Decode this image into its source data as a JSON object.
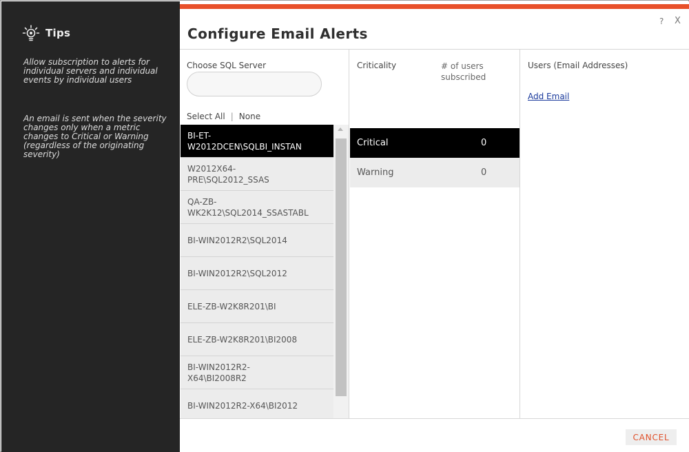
{
  "tips": {
    "title": "Tips",
    "paragraph_1": "Allow subscription to alerts for individual servers and individual events by individual users",
    "paragraph_2": "An email is sent when the severity changes only when a metric changes to Critical or Warning (regardless of the originating severity)"
  },
  "dialog": {
    "title": "Configure Email Alerts",
    "help_label": "?",
    "close_label": "X"
  },
  "server_column": {
    "label": "Choose SQL Server",
    "search_value": "",
    "select_all": "Select All",
    "separator": "|",
    "none": "None",
    "servers": [
      {
        "name": "BI-ET-\nW2012DCEN\\SQLBI_INSTAN",
        "selected": true
      },
      {
        "name": "W2012X64-\nPRE\\SQL2012_SSAS",
        "selected": false
      },
      {
        "name": "QA-ZB-\nWK2K12\\SQL2014_SSASTABL",
        "selected": false
      },
      {
        "name": "BI-WIN2012R2\\SQL2014",
        "selected": false
      },
      {
        "name": "BI-WIN2012R2\\SQL2012",
        "selected": false
      },
      {
        "name": "ELE-ZB-W2K8R201\\BI",
        "selected": false
      },
      {
        "name": "ELE-ZB-W2K8R201\\BI2008",
        "selected": false
      },
      {
        "name": "BI-WIN2012R2-\nX64\\BI2008R2",
        "selected": false
      },
      {
        "name": "BI-WIN2012R2-X64\\BI2012",
        "selected": false
      }
    ]
  },
  "criticality_column": {
    "label": "Criticality",
    "users_label": "# of users\nsubscribed",
    "rows": [
      {
        "name": "Critical",
        "count": "0",
        "selected": true
      },
      {
        "name": "Warning",
        "count": "0",
        "selected": false
      }
    ]
  },
  "email_column": {
    "label": "Users (Email Addresses)",
    "add_email": "Add Email"
  },
  "footer": {
    "cancel_label": "CANCEL"
  },
  "colors": {
    "accent": "#e8502a",
    "sidebar_bg": "#252525",
    "selected_bg": "#000000",
    "link": "#1a3a9c"
  }
}
